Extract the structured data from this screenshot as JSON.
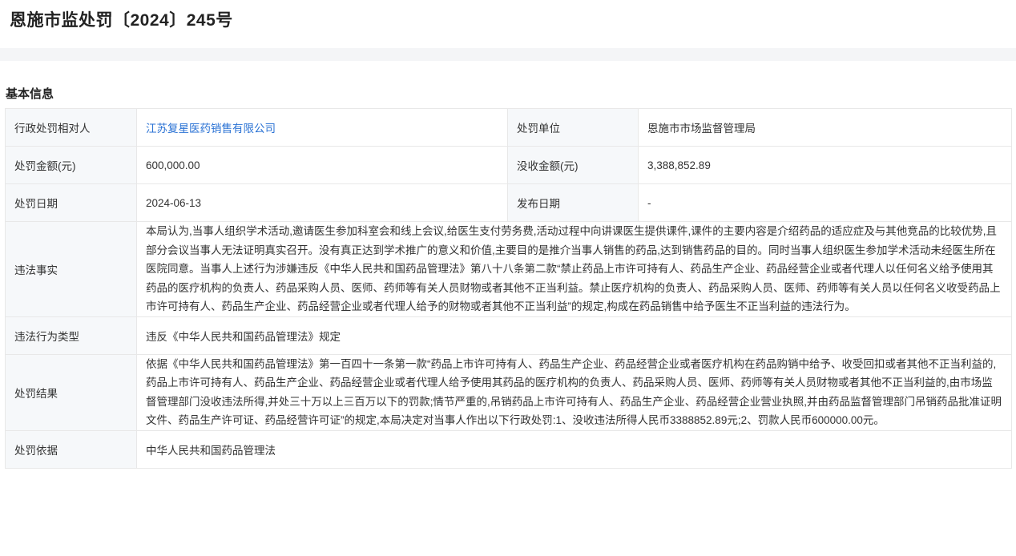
{
  "page": {
    "title": "恩施市监处罚〔2024〕245号"
  },
  "section": {
    "title": "基本信息"
  },
  "fields": {
    "party_label": "行政处罚相对人",
    "party_value": "江苏复星医药销售有限公司",
    "unit_label": "处罚单位",
    "unit_value": "恩施市市场监督管理局",
    "fine_label": "处罚金额(元)",
    "fine_value": "600,000.00",
    "confiscate_label": "没收金额(元)",
    "confiscate_value": "3,388,852.89",
    "date_label": "处罚日期",
    "date_value": "2024-06-13",
    "publish_label": "发布日期",
    "publish_value": "-",
    "facts_label": "违法事实",
    "facts_value": "本局认为,当事人组织学术活动,邀请医生参加科室会和线上会议,给医生支付劳务费,活动过程中向讲课医生提供课件,课件的主要内容是介绍药品的适应症及与其他竞品的比较优势,且部分会议当事人无法证明真实召开。没有真正达到学术推广的意义和价值,主要目的是推介当事人销售的药品,达到销售药品的目的。同时当事人组织医生参加学术活动未经医生所在医院同意。当事人上述行为涉嫌违反《中华人民共和国药品管理法》第八十八条第二款“禁止药品上市许可持有人、药品生产企业、药品经营企业或者代理人以任何名义给予使用其药品的医疗机构的负责人、药品采购人员、医师、药师等有关人员财物或者其他不正当利益。禁止医疗机构的负责人、药品采购人员、医师、药师等有关人员以任何名义收受药品上市许可持有人、药品生产企业、药品经营企业或者代理人给予的财物或者其他不正当利益”的规定,构成在药品销售中给予医生不正当利益的违法行为。",
    "type_label": "违法行为类型",
    "type_value": "违反《中华人民共和国药品管理法》规定",
    "result_label": "处罚结果",
    "result_value": "依据《中华人民共和国药品管理法》第一百四十一条第一款“药品上市许可持有人、药品生产企业、药品经营企业或者医疗机构在药品购销中给予、收受回扣或者其他不正当利益的,药品上市许可持有人、药品生产企业、药品经营企业或者代理人给予使用其药品的医疗机构的负责人、药品采购人员、医师、药师等有关人员财物或者其他不正当利益的,由市场监督管理部门没收违法所得,并处三十万以上三百万以下的罚款;情节严重的,吊销药品上市许可持有人、药品生产企业、药品经营企业营业执照,并由药品监督管理部门吊销药品批准证明文件、药品生产许可证、药品经营许可证”的规定,本局决定对当事人作出以下行政处罚:1、没收违法所得人民币3388852.89元;2、罚款人民币600000.00元。",
    "basis_label": "处罚依据",
    "basis_value": "中华人民共和国药品管理法"
  },
  "colors": {
    "link": "#2a72d4",
    "label_bg": "#f6f8fa",
    "border": "#e8e8e8"
  }
}
